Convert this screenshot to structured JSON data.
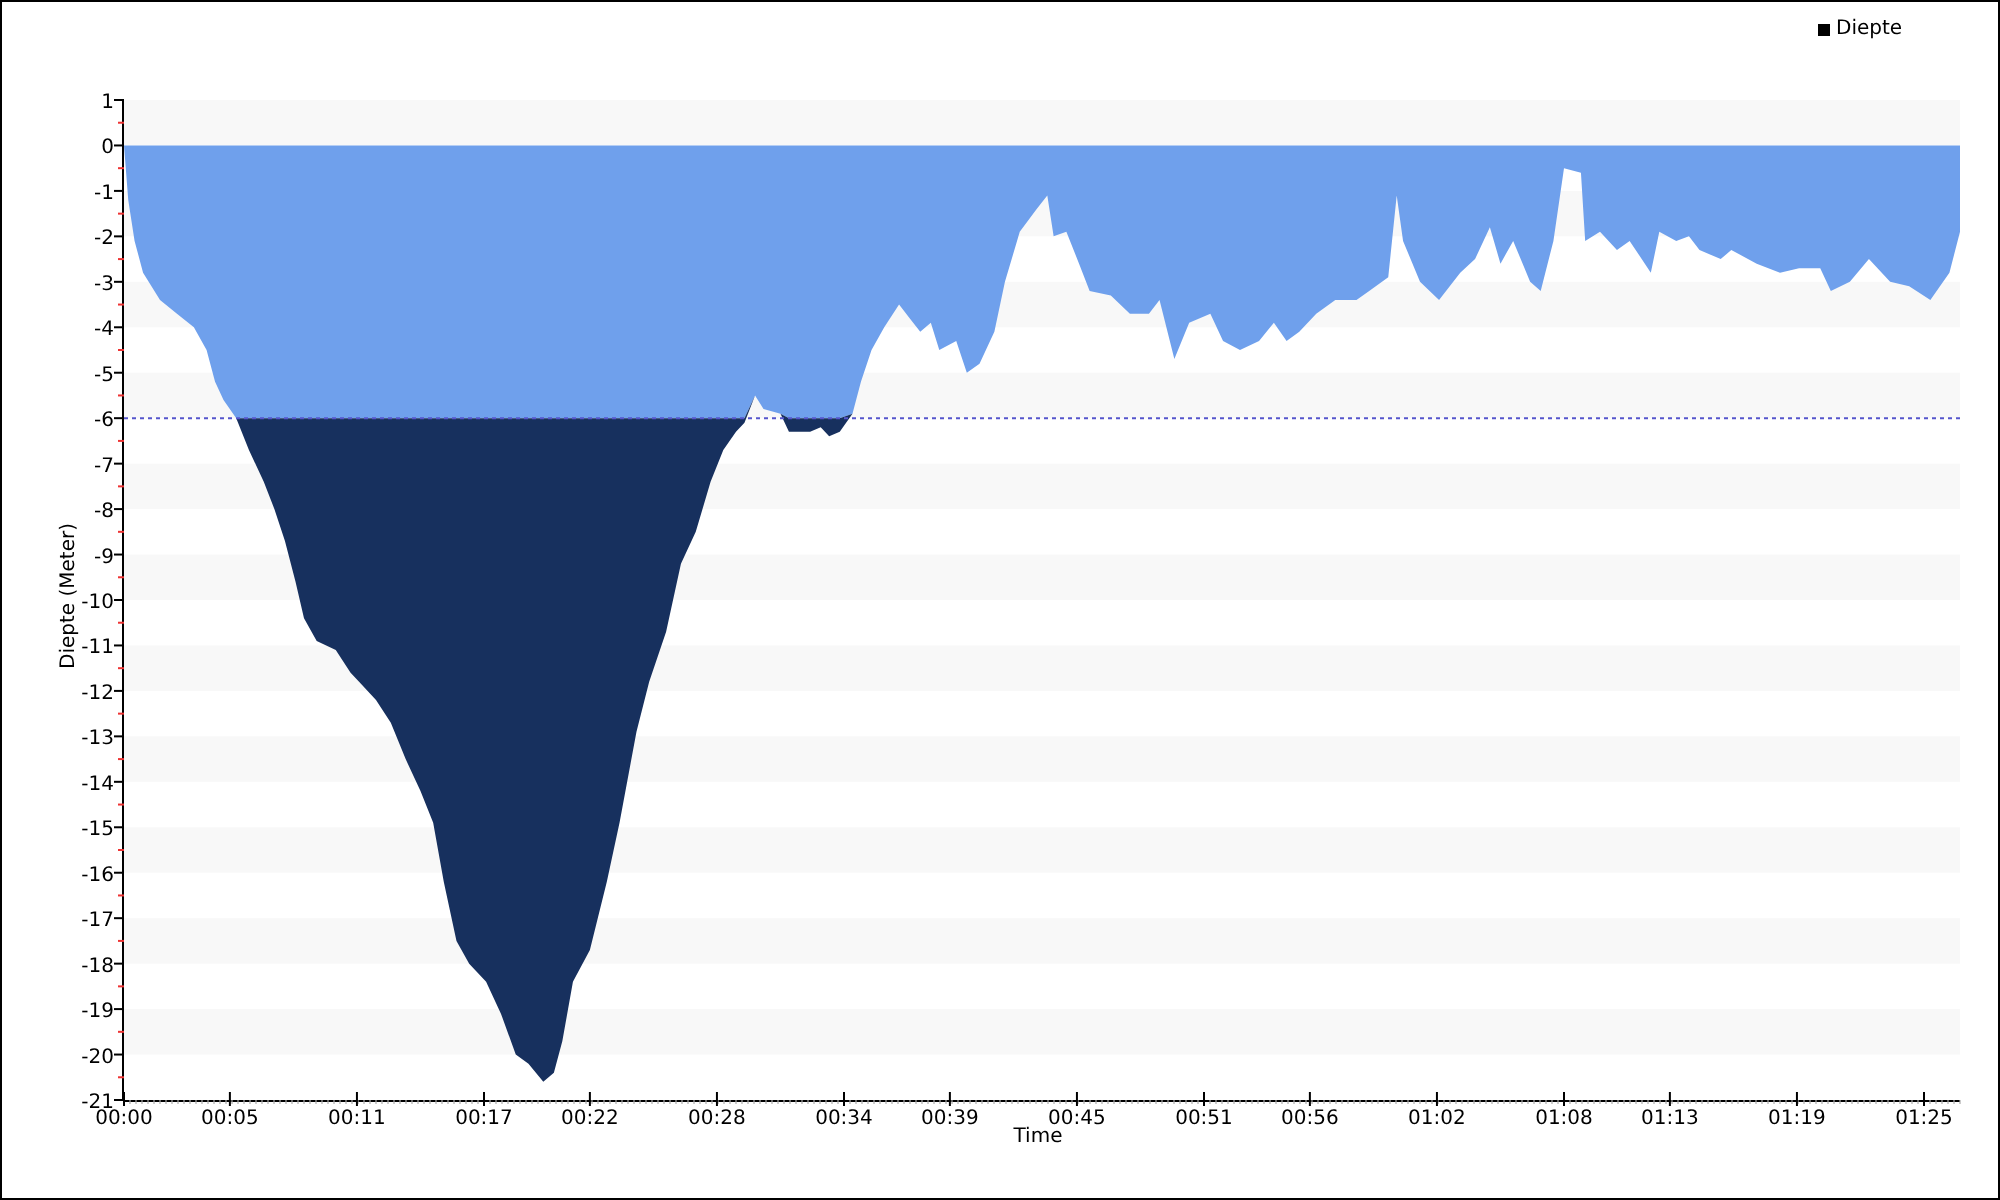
{
  "chart_data": {
    "type": "area",
    "xlabel": "Time",
    "ylabel": "Diepte (Meter)",
    "xlim": [
      0,
      86.7
    ],
    "ylim": [
      -21,
      1
    ],
    "x": [
      0,
      0.2,
      0.5,
      0.9,
      1.7,
      2.5,
      3.3,
      3.9,
      4.3,
      4.7,
      5.3,
      5.9,
      6.6,
      7.1,
      7.6,
      8.1,
      8.5,
      9.1,
      10.0,
      10.7,
      11.1,
      11.9,
      12.6,
      13.3,
      14.0,
      14.6,
      15.1,
      15.7,
      16.3,
      17.1,
      17.8,
      18.5,
      19.1,
      19.8,
      20.3,
      20.7,
      21.2,
      22.0,
      22.8,
      23.4,
      24.2,
      24.8,
      25.6,
      26.3,
      27.0,
      27.7,
      28.3,
      28.9,
      29.3,
      29.8,
      30.2,
      31.0,
      31.4,
      32.4,
      32.9,
      33.3,
      33.8,
      34.4,
      34.8,
      35.3,
      35.9,
      36.6,
      37.1,
      37.6,
      38.1,
      38.5,
      39.3,
      39.8,
      40.4,
      41.1,
      41.6,
      42.3,
      43.1,
      43.6,
      43.9,
      44.5,
      45.1,
      45.6,
      46.6,
      47.5,
      48.4,
      48.9,
      49.6,
      50.3,
      51.3,
      51.9,
      52.7,
      53.6,
      54.3,
      54.9,
      55.5,
      56.3,
      57.2,
      58.2,
      58.8,
      59.7,
      60.1,
      60.4,
      61.2,
      62.1,
      63.1,
      63.8,
      64.5,
      65.0,
      65.6,
      66.4,
      66.9,
      67.5,
      68.0,
      68.8,
      69.0,
      69.7,
      70.5,
      71.1,
      72.1,
      72.5,
      73.3,
      73.9,
      74.4,
      75.4,
      75.9,
      77.1,
      78.2,
      79.1,
      80.1,
      80.6,
      81.5,
      82.4,
      83.4,
      84.3,
      85.3,
      86.2,
      86.7
    ],
    "stacked": true,
    "series": [
      {
        "name": "Diepte",
        "color": "#6fa0ec",
        "values": [
          0,
          -1.2,
          -2.1,
          -2.8,
          -3.4,
          -3.7,
          -4.0,
          -4.5,
          -5.2,
          -5.6,
          -6.0,
          -6,
          -6,
          -6,
          -6,
          -6,
          -6,
          -6,
          -6,
          -6,
          -6,
          -6,
          -6,
          -6,
          -6,
          -6,
          -6,
          -6,
          -6,
          -6,
          -6,
          -6,
          -6,
          -6,
          -6,
          -6,
          -6,
          -6,
          -6,
          -6,
          -6,
          -6,
          -6,
          -6,
          -6,
          -6,
          -6,
          -6,
          -6,
          -5.5,
          -5.8,
          -5.9,
          -6,
          -6,
          -6,
          -6,
          -6,
          -5.9,
          -5.2,
          -4.5,
          -4.0,
          -3.5,
          -3.8,
          -4.1,
          -3.9,
          -4.5,
          -4.3,
          -5.0,
          -4.8,
          -4.1,
          -3.0,
          -1.9,
          -1.4,
          -1.1,
          -2.0,
          -1.9,
          -2.6,
          -3.2,
          -3.3,
          -3.7,
          -3.7,
          -3.4,
          -4.7,
          -3.9,
          -3.7,
          -4.3,
          -4.5,
          -4.3,
          -3.9,
          -4.3,
          -4.1,
          -3.7,
          -3.4,
          -3.4,
          -3.2,
          -2.9,
          -1.1,
          -2.1,
          -3.0,
          -3.4,
          -2.8,
          -2.5,
          -1.8,
          -2.6,
          -2.1,
          -3.0,
          -3.2,
          -2.1,
          -0.5,
          -0.6,
          -2.1,
          -1.9,
          -2.3,
          -2.1,
          -2.8,
          -1.9,
          -2.1,
          -2.0,
          -2.3,
          -2.5,
          -2.3,
          -2.6,
          -2.8,
          -2.7,
          -2.7,
          -3.2,
          -3.0,
          -2.5,
          -3.0,
          -3.1,
          -3.4,
          -2.8,
          -1.9
        ]
      },
      {
        "color": "#17305e",
        "values": [
          0,
          0,
          0,
          0,
          0,
          0,
          0,
          0,
          0,
          0,
          0,
          -0.7,
          -1.4,
          -2.0,
          -2.7,
          -3.6,
          -4.4,
          -4.9,
          -5.1,
          -5.6,
          -5.8,
          -6.2,
          -6.7,
          -7.5,
          -8.2,
          -8.9,
          -10.2,
          -11.5,
          -12.0,
          -12.4,
          -13.1,
          -14.0,
          -14.2,
          -14.6,
          -14.4,
          -13.7,
          -12.4,
          -11.7,
          -10.2,
          -8.9,
          -6.9,
          -5.8,
          -4.7,
          -3.2,
          -2.5,
          -1.4,
          -0.7,
          -0.3,
          -0.1,
          0,
          0,
          0,
          -0.3,
          -0.3,
          -0.2,
          -0.4,
          -0.3,
          0,
          0,
          0,
          0,
          0,
          0,
          0,
          0,
          0,
          0,
          0,
          0,
          0,
          0,
          0,
          0,
          0,
          0,
          0,
          0,
          0,
          0,
          0,
          0,
          0,
          0,
          0,
          0,
          0,
          0,
          0,
          0,
          0,
          0,
          0,
          0,
          0,
          0,
          0,
          0,
          0,
          0,
          0,
          0,
          0,
          0,
          0,
          0,
          0,
          0,
          0,
          0,
          0,
          0,
          0,
          0,
          0,
          0,
          0,
          0,
          0,
          0,
          0,
          0,
          0,
          0,
          0,
          0,
          0,
          0,
          0,
          0,
          0,
          0,
          0,
          0
        ]
      }
    ],
    "xticks": [
      {
        "value": 0,
        "label": "00:00"
      },
      {
        "value": 5,
        "label": "00:05"
      },
      {
        "value": 11,
        "label": "00:11"
      },
      {
        "value": 17,
        "label": "00:17"
      },
      {
        "value": 22,
        "label": "00:22"
      },
      {
        "value": 28,
        "label": "00:28"
      },
      {
        "value": 34,
        "label": "00:34"
      },
      {
        "value": 39,
        "label": "00:39"
      },
      {
        "value": 45,
        "label": "00:45"
      },
      {
        "value": 51,
        "label": "00:51"
      },
      {
        "value": 56,
        "label": "00:56"
      },
      {
        "value": 62,
        "label": "01:02"
      },
      {
        "value": 68,
        "label": "01:08"
      },
      {
        "value": 73,
        "label": "01:13"
      },
      {
        "value": 79,
        "label": "01:19"
      },
      {
        "value": 85,
        "label": "01:25"
      }
    ],
    "yticks": [
      1,
      0,
      -1,
      -2,
      -3,
      -4,
      -5,
      -6,
      -7,
      -8,
      -9,
      -10,
      -11,
      -12,
      -13,
      -14,
      -15,
      -16,
      -17,
      -18,
      -19,
      -20,
      -21
    ],
    "ref_lines": [
      {
        "axis": "y",
        "value": -6,
        "color": "#5555cc"
      }
    ]
  }
}
